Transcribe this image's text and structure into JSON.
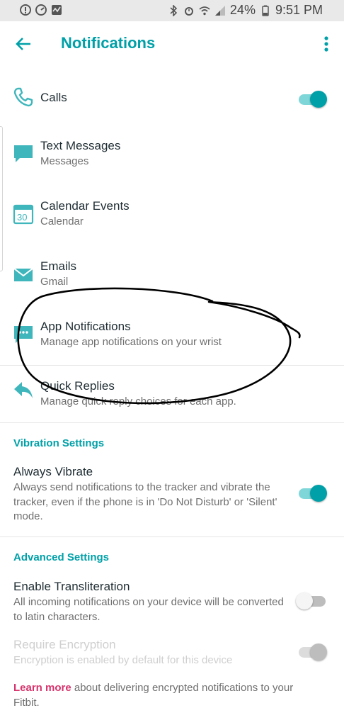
{
  "status_bar": {
    "battery": "24%",
    "time": "9:51 PM"
  },
  "header": {
    "title": "Notifications"
  },
  "notifications": [
    {
      "title": "Calls",
      "subtitle": "",
      "icon": "phone-icon",
      "toggle": true
    },
    {
      "title": "Text Messages",
      "subtitle": "Messages",
      "icon": "message-icon"
    },
    {
      "title": "Calendar Events",
      "subtitle": "Calendar",
      "icon": "calendar-icon",
      "calendar_day": "30"
    },
    {
      "title": "Emails",
      "subtitle": "Gmail",
      "icon": "mail-icon"
    },
    {
      "title": "App Notifications",
      "subtitle": "Manage app notifications on your wrist",
      "icon": "app-chat-icon"
    },
    {
      "title": "Quick Replies",
      "subtitle": "Manage quick reply choices for each app.",
      "icon": "reply-icon"
    }
  ],
  "vibration": {
    "header": "Vibration Settings",
    "always_vibrate": {
      "title": "Always Vibrate",
      "description": "Always send notifications to the tracker and vibrate the tracker, even if the phone is in 'Do Not Disturb' or 'Silent' mode.",
      "enabled": true
    }
  },
  "advanced": {
    "header": "Advanced Settings",
    "transliteration": {
      "title": "Enable Transliteration",
      "description": "All incoming notifications on your device will be converted to latin characters.",
      "enabled": false
    },
    "encryption": {
      "title": "Require Encryption",
      "description": "Encryption is enabled by default for this device",
      "enabled": true,
      "disabled": true
    },
    "learn_more": {
      "link": "Learn more",
      "text": " about delivering encrypted notifications to your Fitbit."
    }
  },
  "colors": {
    "accent": "#00a0a8",
    "link": "#d6336c",
    "annotation": "#000000"
  }
}
